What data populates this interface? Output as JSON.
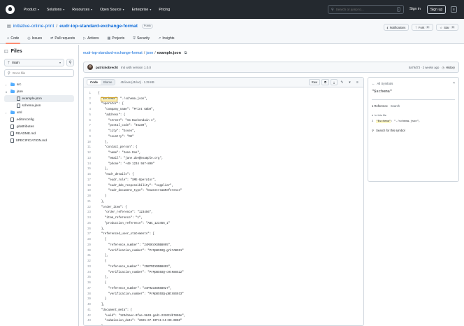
{
  "nav": {
    "items": [
      "Product",
      "Solutions",
      "Resources",
      "Open Source",
      "Enterprise",
      "Pricing"
    ],
    "search_placeholder": "Search or jump to...",
    "slash_key": "/",
    "sign_in": "Sign in",
    "sign_up": "Sign up"
  },
  "repo": {
    "owner": "initiative-online-print",
    "name": "eudr-iop-standard-exchange-format",
    "visibility": "Public",
    "notifications_label": "Notifications",
    "fork_label": "Fork",
    "fork_count": "0",
    "star_label": "Star",
    "star_count": "3",
    "tabs": [
      "Code",
      "Issues",
      "Pull requests",
      "Actions",
      "Projects",
      "Security",
      "Insights"
    ]
  },
  "sidebar": {
    "title": "Files",
    "branch": "main",
    "goto_placeholder": "Go to file",
    "tree": [
      {
        "name": "src",
        "type": "dir",
        "depth": 0,
        "open": false
      },
      {
        "name": "json",
        "type": "dir",
        "depth": 0,
        "open": true
      },
      {
        "name": "example.json",
        "type": "file",
        "depth": 1,
        "selected": true
      },
      {
        "name": "schema.json",
        "type": "file",
        "depth": 1
      },
      {
        "name": "xml",
        "type": "dir",
        "depth": 0,
        "open": false
      },
      {
        "name": ".editorconfig",
        "type": "file",
        "depth": 0
      },
      {
        "name": ".gitattributes",
        "type": "file",
        "depth": 0
      },
      {
        "name": "README.md",
        "type": "file",
        "depth": 0
      },
      {
        "name": "SPECIFICATION.md",
        "type": "file",
        "depth": 0
      }
    ]
  },
  "breadcrumb": {
    "repo": "eudr-iop-standard-exchange-format",
    "folder": "json",
    "file": "example.json"
  },
  "commit": {
    "author": "patrickobrecht",
    "message": "Init with version 1.0.0",
    "hash_time": "5a79d73 · 2 weeks ago",
    "history": "History"
  },
  "code": {
    "tab_code": "Code",
    "tab_blame": "Blame",
    "line_info": "45 lines (45 loc) · 1.29 KB",
    "raw_label": "Raw",
    "lines": [
      "{",
      "  \"$schema\": \"./schema.json\",",
      "  \"operator\": {",
      "    \"company_name\": \"Print GmbH\",",
      "    \"address\": {",
      "      \"street\": \"Am Buchendain 4\",",
      "      \"postal_code\": \"45239\",",
      "      \"city\": \"Essen\",",
      "      \"country\": \"DE\"",
      "    },",
      "    \"contact_person\": {",
      "      \"name\": \"Jane Doe\",",
      "      \"email\": \"jane.doe@example.org\",",
      "      \"phone\": \"+49 1234 567-890\"",
      "    },",
      "    \"eudr_details\": {",
      "      \"eudr_role\": \"SME-Operator\",",
      "      \"eudr_dds_responsibility\": \"supplier\",",
      "      \"eudr_document_type\": \"DownstreamReference\"",
      "    }",
      "  },",
      "  \"order_item\": {",
      "    \"order_reference\": \"123456\",",
      "    \"item_reference\": \"1\",",
      "    \"production_reference\": \"ABC_123456_1\"",
      "  },",
      "  \"referenced_user_statements\": [",
      "    {",
      "      \"reference_number\": \"24MXKVXSNB8095\",",
      "      \"verification_number\": \"PrMpBS5SQ-grk7ABS51\"",
      "    },",
      "    {",
      "      \"reference_number\": \"25BTMIXDNB889S\",",
      "      \"verification_number\": \"PrMpBS5SQ-cHtK88S22\"",
      "    },",
      "    {",
      "      \"reference_number\": \"24FRZ33SNS8027\",",
      "      \"verification_number\": \"PrMpBS5SQ-pBtX8S933\"",
      "    }",
      "  ],",
      "  \"document_meta\": {",
      "    \"uuid\": \"123d1aec-0fae-9849-ged1-2326tdb7890e\",",
      "    \"submission_date\": \"2025-07-03T11:15:00.000Z\"",
      "  }",
      "}"
    ]
  },
  "symbols": {
    "title": "All Symbols",
    "symbol": "\"$schema\"",
    "tab_reference": "1 Reference",
    "tab_search": "Search",
    "in_this_file": "In this file",
    "ref_line_no": "2",
    "ref_key": "\"$schema\"",
    "ref_rest": ": \"./schema.json\",",
    "search_symbol": "Search for this symbol"
  }
}
